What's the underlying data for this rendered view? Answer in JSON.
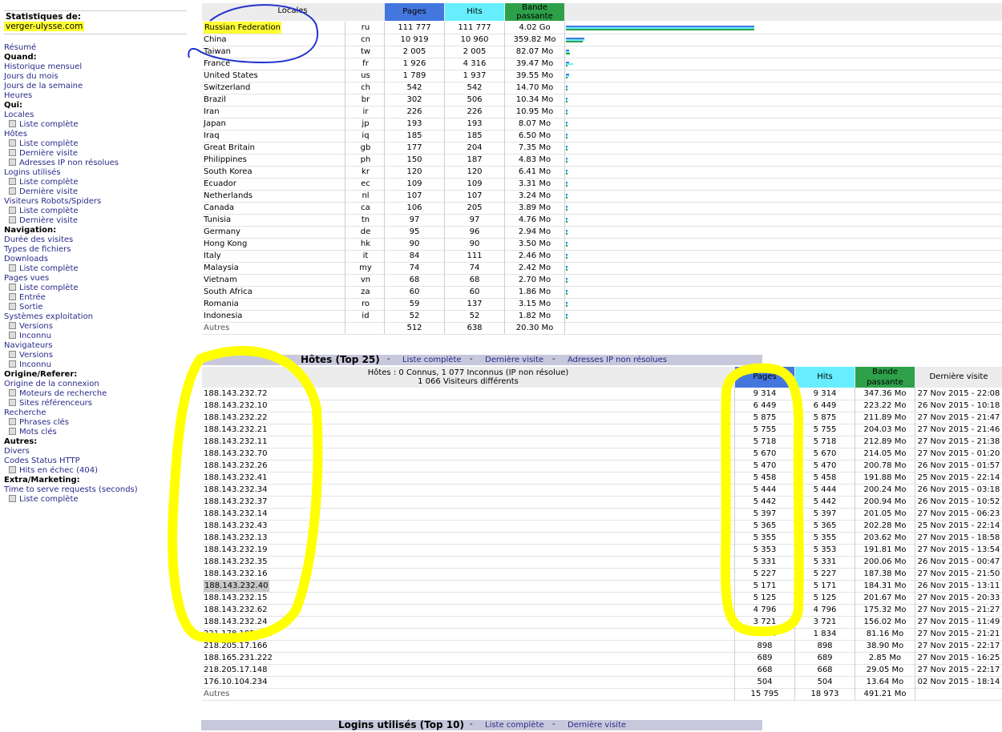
{
  "sidebar": {
    "stats_label": "Statistiques de:",
    "site": "verger-ulysse.com",
    "nav": [
      {
        "t": "Résumé",
        "k": "link"
      },
      {
        "t": "Quand:",
        "k": "head"
      },
      {
        "t": "Historique mensuel",
        "k": "link"
      },
      {
        "t": "Jours du mois",
        "k": "link"
      },
      {
        "t": "Jours de la semaine",
        "k": "link"
      },
      {
        "t": "Heures",
        "k": "link"
      },
      {
        "t": "Qui:",
        "k": "head"
      },
      {
        "t": "Locales",
        "k": "link"
      },
      {
        "t": "Liste complète",
        "k": "sub"
      },
      {
        "t": "Hôtes",
        "k": "link"
      },
      {
        "t": "Liste complète",
        "k": "sub"
      },
      {
        "t": "Dernière visite",
        "k": "sub"
      },
      {
        "t": "Adresses IP non résolues",
        "k": "sub"
      },
      {
        "t": "Logins utilisés",
        "k": "link"
      },
      {
        "t": "Liste complète",
        "k": "sub"
      },
      {
        "t": "Dernière visite",
        "k": "sub"
      },
      {
        "t": "Visiteurs Robots/Spiders",
        "k": "link"
      },
      {
        "t": "Liste complète",
        "k": "sub"
      },
      {
        "t": "Dernière visite",
        "k": "sub"
      },
      {
        "t": "Navigation:",
        "k": "head"
      },
      {
        "t": "Durée des visites",
        "k": "link"
      },
      {
        "t": "Types de fichiers",
        "k": "link"
      },
      {
        "t": "Downloads",
        "k": "link"
      },
      {
        "t": "Liste complète",
        "k": "sub"
      },
      {
        "t": "Pages vues",
        "k": "link"
      },
      {
        "t": "Liste complète",
        "k": "sub"
      },
      {
        "t": "Entrée",
        "k": "sub"
      },
      {
        "t": "Sortie",
        "k": "sub"
      },
      {
        "t": "Systèmes exploitation",
        "k": "link"
      },
      {
        "t": "Versions",
        "k": "sub"
      },
      {
        "t": "Inconnu",
        "k": "sub"
      },
      {
        "t": "Navigateurs",
        "k": "link"
      },
      {
        "t": "Versions",
        "k": "sub"
      },
      {
        "t": "Inconnu",
        "k": "sub"
      },
      {
        "t": "Origine/Referer:",
        "k": "head"
      },
      {
        "t": "Origine de la connexion",
        "k": "link"
      },
      {
        "t": "Moteurs de recherche",
        "k": "sub"
      },
      {
        "t": "Sites référenceurs",
        "k": "sub"
      },
      {
        "t": "Recherche",
        "k": "link"
      },
      {
        "t": "Phrases clés",
        "k": "sub"
      },
      {
        "t": "Mots clés",
        "k": "sub"
      },
      {
        "t": "Autres:",
        "k": "head"
      },
      {
        "t": "Divers",
        "k": "link"
      },
      {
        "t": "Codes Status HTTP",
        "k": "link"
      },
      {
        "t": "Hits en échec (404)",
        "k": "sub"
      },
      {
        "t": "Extra/Marketing:",
        "k": "head"
      },
      {
        "t": "Time to serve requests (seconds)",
        "k": "link"
      },
      {
        "t": "Liste complète",
        "k": "sub"
      }
    ]
  },
  "colors": {
    "pages": "#4477dd",
    "hits": "#66eeff",
    "bandwidth": "#2ea04a",
    "highlight": "#ffff33",
    "annotation_blue": "#2233cc",
    "annotation_yellow": "#ffff00"
  },
  "locales": {
    "headers": {
      "locales": "Locales",
      "pages": "Pages",
      "hits": "Hits",
      "bw": "Bande passante"
    },
    "rows": [
      {
        "name": "Russian Federation",
        "code": "ru",
        "pages": "111 777",
        "hits": "111 777",
        "bw": "4.02 Go",
        "p": 111777,
        "h": 111777,
        "b": 4116
      },
      {
        "name": "China",
        "code": "cn",
        "pages": "10 919",
        "hits": "10 960",
        "bw": "359.82 Mo",
        "p": 10919,
        "h": 10960,
        "b": 359.82
      },
      {
        "name": "Taiwan",
        "code": "tw",
        "pages": "2 005",
        "hits": "2 005",
        "bw": "82.07 Mo",
        "p": 2005,
        "h": 2005,
        "b": 82.07
      },
      {
        "name": "France",
        "code": "fr",
        "pages": "1 926",
        "hits": "4 316",
        "bw": "39.47 Mo",
        "p": 1926,
        "h": 4316,
        "b": 39.47
      },
      {
        "name": "United States",
        "code": "us",
        "pages": "1 789",
        "hits": "1 937",
        "bw": "39.55 Mo",
        "p": 1789,
        "h": 1937,
        "b": 39.55
      },
      {
        "name": "Switzerland",
        "code": "ch",
        "pages": "542",
        "hits": "542",
        "bw": "14.70 Mo",
        "p": 542,
        "h": 542,
        "b": 14.7
      },
      {
        "name": "Brazil",
        "code": "br",
        "pages": "302",
        "hits": "506",
        "bw": "10.34 Mo",
        "p": 302,
        "h": 506,
        "b": 10.34
      },
      {
        "name": "Iran",
        "code": "ir",
        "pages": "226",
        "hits": "226",
        "bw": "10.95 Mo",
        "p": 226,
        "h": 226,
        "b": 10.95
      },
      {
        "name": "Japan",
        "code": "jp",
        "pages": "193",
        "hits": "193",
        "bw": "8.07 Mo",
        "p": 193,
        "h": 193,
        "b": 8.07
      },
      {
        "name": "Iraq",
        "code": "iq",
        "pages": "185",
        "hits": "185",
        "bw": "6.50 Mo",
        "p": 185,
        "h": 185,
        "b": 6.5
      },
      {
        "name": "Great Britain",
        "code": "gb",
        "pages": "177",
        "hits": "204",
        "bw": "7.35 Mo",
        "p": 177,
        "h": 204,
        "b": 7.35
      },
      {
        "name": "Philippines",
        "code": "ph",
        "pages": "150",
        "hits": "187",
        "bw": "4.83 Mo",
        "p": 150,
        "h": 187,
        "b": 4.83
      },
      {
        "name": "South Korea",
        "code": "kr",
        "pages": "120",
        "hits": "120",
        "bw": "6.41 Mo",
        "p": 120,
        "h": 120,
        "b": 6.41
      },
      {
        "name": "Ecuador",
        "code": "ec",
        "pages": "109",
        "hits": "109",
        "bw": "3.31 Mo",
        "p": 109,
        "h": 109,
        "b": 3.31
      },
      {
        "name": "Netherlands",
        "code": "nl",
        "pages": "107",
        "hits": "107",
        "bw": "3.24 Mo",
        "p": 107,
        "h": 107,
        "b": 3.24
      },
      {
        "name": "Canada",
        "code": "ca",
        "pages": "106",
        "hits": "205",
        "bw": "3.89 Mo",
        "p": 106,
        "h": 205,
        "b": 3.89
      },
      {
        "name": "Tunisia",
        "code": "tn",
        "pages": "97",
        "hits": "97",
        "bw": "4.76 Mo",
        "p": 97,
        "h": 97,
        "b": 4.76
      },
      {
        "name": "Germany",
        "code": "de",
        "pages": "95",
        "hits": "96",
        "bw": "2.94 Mo",
        "p": 95,
        "h": 96,
        "b": 2.94
      },
      {
        "name": "Hong Kong",
        "code": "hk",
        "pages": "90",
        "hits": "90",
        "bw": "3.50 Mo",
        "p": 90,
        "h": 90,
        "b": 3.5
      },
      {
        "name": "Italy",
        "code": "it",
        "pages": "84",
        "hits": "111",
        "bw": "2.46 Mo",
        "p": 84,
        "h": 111,
        "b": 2.46
      },
      {
        "name": "Malaysia",
        "code": "my",
        "pages": "74",
        "hits": "74",
        "bw": "2.42 Mo",
        "p": 74,
        "h": 74,
        "b": 2.42
      },
      {
        "name": "Vietnam",
        "code": "vn",
        "pages": "68",
        "hits": "68",
        "bw": "2.70 Mo",
        "p": 68,
        "h": 68,
        "b": 2.7
      },
      {
        "name": "South Africa",
        "code": "za",
        "pages": "60",
        "hits": "60",
        "bw": "1.86 Mo",
        "p": 60,
        "h": 60,
        "b": 1.86
      },
      {
        "name": "Romania",
        "code": "ro",
        "pages": "59",
        "hits": "137",
        "bw": "3.15 Mo",
        "p": 59,
        "h": 137,
        "b": 3.15
      },
      {
        "name": "Indonesia",
        "code": "id",
        "pages": "52",
        "hits": "52",
        "bw": "1.82 Mo",
        "p": 52,
        "h": 52,
        "b": 1.82
      },
      {
        "name": "Autres",
        "code": "",
        "pages": "512",
        "hits": "638",
        "bw": "20.30 Mo",
        "p": 0,
        "h": 0,
        "b": 0
      }
    ]
  },
  "hosts": {
    "title": "Hôtes (Top 25)",
    "links": [
      "Liste complète",
      "Dernière visite",
      "Adresses IP non résolues"
    ],
    "summary_1": "Hôtes : 0 Connus, 1 077 Inconnus (IP non résolue)",
    "summary_2": "1 066 Visiteurs différents",
    "headers": {
      "pages": "Pages",
      "hits": "Hits",
      "bw": "Bande passante",
      "last": "Dernière visite"
    },
    "rows": [
      {
        "ip": "188.143.232.72",
        "pages": "9 314",
        "hits": "9 314",
        "bw": "347.36 Mo",
        "last": "27 Nov 2015 - 22:08"
      },
      {
        "ip": "188.143.232.10",
        "pages": "6 449",
        "hits": "6 449",
        "bw": "223.22 Mo",
        "last": "26 Nov 2015 - 10:18"
      },
      {
        "ip": "188.143.232.22",
        "pages": "5 875",
        "hits": "5 875",
        "bw": "211.89 Mo",
        "last": "27 Nov 2015 - 21:47"
      },
      {
        "ip": "188.143.232.21",
        "pages": "5 755",
        "hits": "5 755",
        "bw": "204.03 Mo",
        "last": "27 Nov 2015 - 21:46"
      },
      {
        "ip": "188.143.232.11",
        "pages": "5 718",
        "hits": "5 718",
        "bw": "212.89 Mo",
        "last": "27 Nov 2015 - 21:38"
      },
      {
        "ip": "188.143.232.70",
        "pages": "5 670",
        "hits": "5 670",
        "bw": "214.05 Mo",
        "last": "27 Nov 2015 - 01:20"
      },
      {
        "ip": "188.143.232.26",
        "pages": "5 470",
        "hits": "5 470",
        "bw": "200.78 Mo",
        "last": "26 Nov 2015 - 01:57"
      },
      {
        "ip": "188.143.232.41",
        "pages": "5 458",
        "hits": "5 458",
        "bw": "191.88 Mo",
        "last": "25 Nov 2015 - 22:14"
      },
      {
        "ip": "188.143.232.34",
        "pages": "5 444",
        "hits": "5 444",
        "bw": "200.24 Mo",
        "last": "26 Nov 2015 - 03:18"
      },
      {
        "ip": "188.143.232.37",
        "pages": "5 442",
        "hits": "5 442",
        "bw": "200.94 Mo",
        "last": "26 Nov 2015 - 10:52"
      },
      {
        "ip": "188.143.232.14",
        "pages": "5 397",
        "hits": "5 397",
        "bw": "201.05 Mo",
        "last": "27 Nov 2015 - 06:23"
      },
      {
        "ip": "188.143.232.43",
        "pages": "5 365",
        "hits": "5 365",
        "bw": "202.28 Mo",
        "last": "25 Nov 2015 - 22:14"
      },
      {
        "ip": "188.143.232.13",
        "pages": "5 355",
        "hits": "5 355",
        "bw": "203.62 Mo",
        "last": "27 Nov 2015 - 18:58"
      },
      {
        "ip": "188.143.232.19",
        "pages": "5 353",
        "hits": "5 353",
        "bw": "191.81 Mo",
        "last": "27 Nov 2015 - 13:54"
      },
      {
        "ip": "188.143.232.35",
        "pages": "5 331",
        "hits": "5 331",
        "bw": "200.06 Mo",
        "last": "26 Nov 2015 - 00:47"
      },
      {
        "ip": "188.143.232.16",
        "pages": "5 227",
        "hits": "5 227",
        "bw": "187.38 Mo",
        "last": "27 Nov 2015 - 21:50"
      },
      {
        "ip": "188.143.232.40",
        "pages": "5 171",
        "hits": "5 171",
        "bw": "184.31 Mo",
        "last": "26 Nov 2015 - 13:11"
      },
      {
        "ip": "188.143.232.15",
        "pages": "5 125",
        "hits": "5 125",
        "bw": "201.67 Mo",
        "last": "27 Nov 2015 - 20:33"
      },
      {
        "ip": "188.143.232.62",
        "pages": "4 796",
        "hits": "4 796",
        "bw": "175.32 Mo",
        "last": "27 Nov 2015 - 21:27"
      },
      {
        "ip": "188.143.232.24",
        "pages": "3 721",
        "hits": "3 721",
        "bw": "156.02 Mo",
        "last": "27 Nov 2015 - 11:49"
      },
      {
        "ip": "221.178.182.144",
        "pages": "1 834",
        "hits": "1 834",
        "bw": "81.16 Mo",
        "last": "27 Nov 2015 - 21:21"
      },
      {
        "ip": "218.205.17.166",
        "pages": "898",
        "hits": "898",
        "bw": "38.90 Mo",
        "last": "27 Nov 2015 - 22:17"
      },
      {
        "ip": "188.165.231.222",
        "pages": "689",
        "hits": "689",
        "bw": "2.85 Mo",
        "last": "27 Nov 2015 - 16:25"
      },
      {
        "ip": "218.205.17.148",
        "pages": "668",
        "hits": "668",
        "bw": "29.05 Mo",
        "last": "27 Nov 2015 - 22:17"
      },
      {
        "ip": "176.10.104.234",
        "pages": "504",
        "hits": "504",
        "bw": "13.64 Mo",
        "last": "02 Nov 2015 - 18:14"
      },
      {
        "ip": "Autres",
        "pages": "15 795",
        "hits": "18 973",
        "bw": "491.21 Mo",
        "last": ""
      }
    ]
  },
  "logins": {
    "title": "Logins utilisés (Top 10)",
    "links": [
      "Liste complète",
      "Dernière visite"
    ]
  }
}
